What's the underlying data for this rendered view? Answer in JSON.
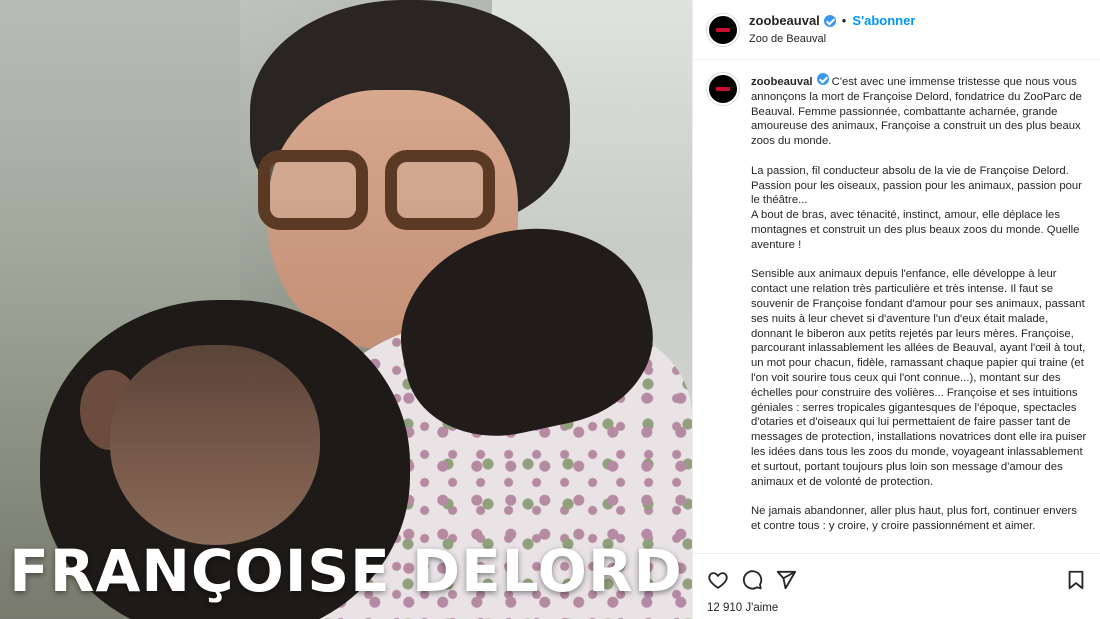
{
  "photo": {
    "caption_text": "FRANÇOISE DELORD"
  },
  "header": {
    "username": "zoobeauval",
    "separator": "•",
    "follow_label": "S'abonner",
    "location": "Zoo de Beauval",
    "icon": "verified-badge-icon"
  },
  "post": {
    "username": "zoobeauval",
    "text": " C'est avec une immense tristesse que nous vous annonçons la mort de Françoise Delord, fondatrice du ZooParc de Beauval. Femme passionnée, combattante acharnée, grande amoureuse des animaux, Françoise a construit un des plus beaux zoos du monde.\n\nLa passion, fil conducteur absolu de la vie de Françoise Delord. Passion pour les oiseaux, passion pour les animaux, passion pour le théâtre...\nA bout de bras, avec ténacité, instinct, amour, elle déplace les montagnes et construit un des plus beaux zoos du monde. Quelle aventure !\n\nSensible aux animaux depuis l'enfance, elle développe à leur contact une relation très particulière et très intense. Il faut se souvenir de Françoise fondant d'amour pour ses animaux, passant ses nuits à leur chevet si d'aventure l'un d'eux était malade, donnant le biberon aux petits rejetés par leurs mères. Françoise, parcourant inlassablement les allées de Beauval, ayant l'œil à tout, un mot pour chacun, fidèle, ramassant chaque papier qui traine (et l'on voit sourire tous ceux qui l'ont connue...), montant sur des échelles pour construire des volières... Françoise et ses intuitions géniales : serres tropicales gigantesques de l'époque, spectacles d'otaries et d'oiseaux qui lui permettaient de faire passer tant de messages de protection, installations novatrices dont elle ira puiser les idées dans tous les zoos du monde, voyageant inlassablement et surtout, portant toujours plus loin son message d'amour des animaux et de volonté de protection.\n\nNe jamais abandonner, aller plus haut, plus fort, continuer envers et contre tous : y croire, y croire passionnément et aimer."
  },
  "actions": {
    "icons": [
      "heart-icon",
      "comment-icon",
      "share-icon",
      "bookmark-icon"
    ],
    "likes": "12 910 J'aime"
  },
  "colors": {
    "accent": "#0095f6",
    "verified": "#3897f0",
    "text": "#262626",
    "border": "#efefef"
  }
}
